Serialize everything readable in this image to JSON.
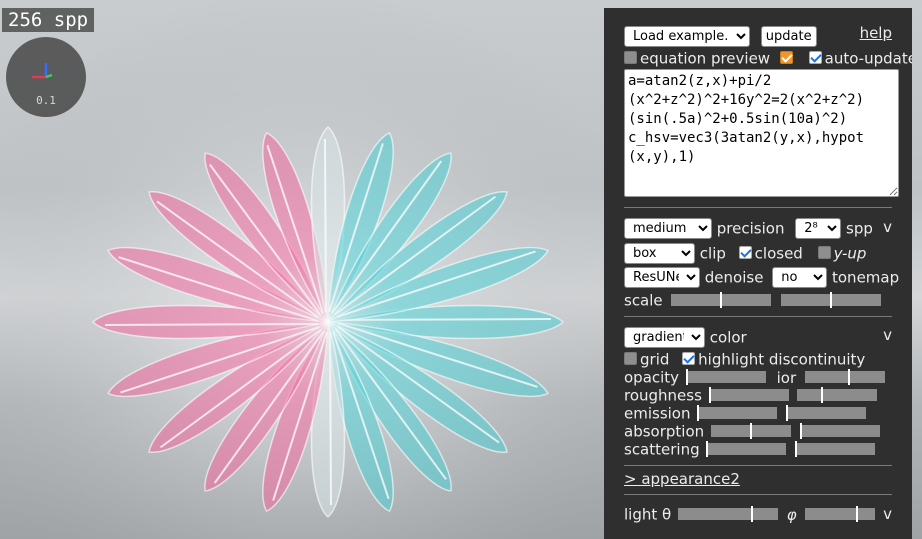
{
  "viewport": {
    "spp_label": "256 spp",
    "axis_scale": "0.1"
  },
  "panel": {
    "load_example": "Load example...",
    "update_label": "update",
    "help_label": "help",
    "equation_preview_label": "equation preview",
    "auto_update_label": "auto-update",
    "equation_lines": [
      "a=atan2(z,x)+pi/2",
      "(x^2+z^2)^2+16y^2=2(x^2+z^2)",
      "(sin(.5a)^2+0.5sin(10a)^2)",
      "c_hsv=vec3(3atan2(y,x),hypot",
      "(x,y),1)"
    ],
    "render": {
      "precision_value": "medium",
      "precision_label": "precision",
      "spp_value": "2⁸",
      "spp_label": "spp",
      "clip_value": "box",
      "clip_label": "clip",
      "closed_label": "closed",
      "yup_label": "y-up",
      "denoise_value": "ResUNet",
      "denoise_label": "denoise",
      "tonemap_value": "no",
      "tonemap_label": "tonemap",
      "scale_label": "scale",
      "toggle": "v"
    },
    "color": {
      "mode_value": "gradient",
      "mode_label": "color",
      "grid_label": "grid",
      "highlight_label": "highlight discontinuity",
      "opacity_label": "opacity",
      "ior_label": "ior",
      "roughness_label": "roughness",
      "emission_label": "emission",
      "absorption_label": "absorption",
      "scattering_label": "scattering",
      "toggle": "v"
    },
    "appearance2_label": "> appearance2",
    "light": {
      "theta_label": "light θ",
      "phi_label": "φ",
      "toggle": "v"
    }
  },
  "colors": {
    "panel_bg": "#2f2f2f",
    "checkbox_accent": "#1a73e8",
    "preview_accent": "#f0962c"
  }
}
